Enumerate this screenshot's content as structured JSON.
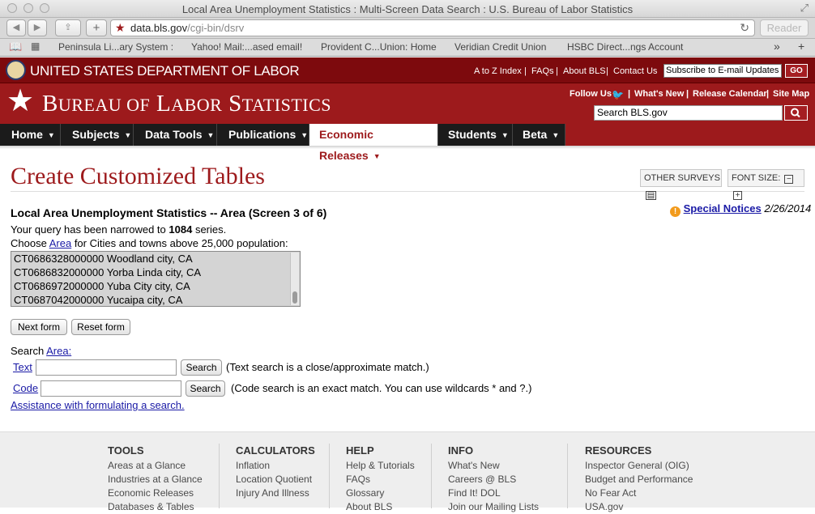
{
  "browser": {
    "window_title": "Local Area Unemployment Statistics : Multi-Screen Data Search : U.S. Bureau of Labor Statistics",
    "url_host": "data.bls.gov",
    "url_path": "/cgi-bin/dsrv",
    "reader_label": "Reader",
    "bookmarks": [
      "Peninsula Li...ary System :",
      "Yahoo! Mail:...ased email!",
      "Provident C...Union: Home",
      "Veridian Credit Union",
      "HSBC Direct...ngs Account"
    ],
    "bookmarks_more": "»"
  },
  "dol": {
    "name": "UNITED STATES DEPARTMENT OF LABOR",
    "links": [
      "A to Z Index",
      "FAQs",
      "About BLS",
      "Contact Us"
    ],
    "subscribe_placeholder": "Subscribe to E-mail Updates",
    "go_label": "GO"
  },
  "bls": {
    "name": "Bureau of Labor Statistics",
    "follow_us": "Follow Us",
    "header_links": [
      "What's New",
      "Release Calendar",
      "Site Map"
    ],
    "search_placeholder": "Search BLS.gov"
  },
  "nav": {
    "items": [
      "Home",
      "Subjects",
      "Data Tools",
      "Publications",
      "Economic Releases",
      "Students",
      "Beta"
    ],
    "active": "Economic Releases"
  },
  "page": {
    "title": "Create Customized Tables",
    "other_surveys": "OTHER SURVEYS",
    "font_size": "FONT SIZE:",
    "subheading": "Local Area Unemployment Statistics -- Area (Screen 3 of 6)",
    "special_notices": "Special Notices",
    "special_notices_date": "2/26/2014",
    "query_prefix": "Your query has been narrowed to",
    "query_count": "1084",
    "query_suffix": "series.",
    "choose_prefix": "Choose",
    "choose_link": "Area",
    "choose_suffix": "for Cities and towns above 25,000 population:",
    "list_items": [
      "CT0686328000000 Woodland city, CA",
      "CT0686832000000 Yorba Linda city, CA",
      "CT0686972000000 Yuba City city, CA",
      "CT0687042000000 Yucaipa city, CA"
    ],
    "next_form": "Next form",
    "reset_form": "Reset form",
    "search_label": "Search",
    "search_area_link": "Area:",
    "text_link": "Text",
    "search_button": "Search",
    "text_note": "(Text search is a close/approximate match.)",
    "code_link": "Code",
    "code_note": "(Code search is an exact match. You can use wildcards * and ?.)",
    "assistance_link": "Assistance with formulating a search."
  },
  "footer": {
    "columns": [
      {
        "title": "TOOLS",
        "links": [
          "Areas at a Glance",
          "Industries at a Glance",
          "Economic Releases",
          "Databases & Tables"
        ]
      },
      {
        "title": "CALCULATORS",
        "links": [
          "Inflation",
          "Location Quotient",
          "Injury And Illness"
        ]
      },
      {
        "title": "HELP",
        "links": [
          "Help & Tutorials",
          "FAQs",
          "Glossary",
          "About BLS"
        ]
      },
      {
        "title": "INFO",
        "links": [
          "What's New",
          "Careers @ BLS",
          "Find It! DOL",
          "Join our Mailing Lists"
        ]
      },
      {
        "title": "RESOURCES",
        "links": [
          "Inspector General (OIG)",
          "Budget and Performance",
          "No Fear Act",
          "USA.gov"
        ]
      }
    ]
  },
  "colors": {
    "bls_red": "#9d1a1c",
    "dol_red": "#7d0a0d",
    "nav_black": "#1b1b1b",
    "link_blue": "#1a1aa6"
  }
}
